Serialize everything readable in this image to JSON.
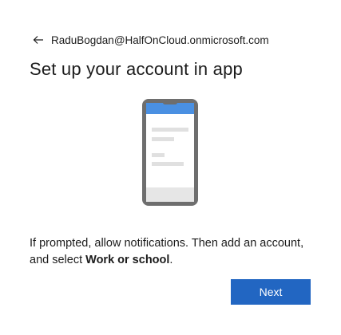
{
  "identity": {
    "email": "RaduBogdan@HalfOnCloud.onmicrosoft.com",
    "back_icon": "arrow-left-icon"
  },
  "page": {
    "title": "Set up your account in app"
  },
  "illustration": {
    "icon": "phone-illustration",
    "accent_color": "#4a90e2",
    "frame_color": "#6e6e6e"
  },
  "description": {
    "text_before": "If prompted, allow notifications. Then add an account, and select ",
    "emphasis": "Work or school",
    "text_after": "."
  },
  "actions": {
    "next_label": "Next",
    "next_color": "#2266c2"
  }
}
